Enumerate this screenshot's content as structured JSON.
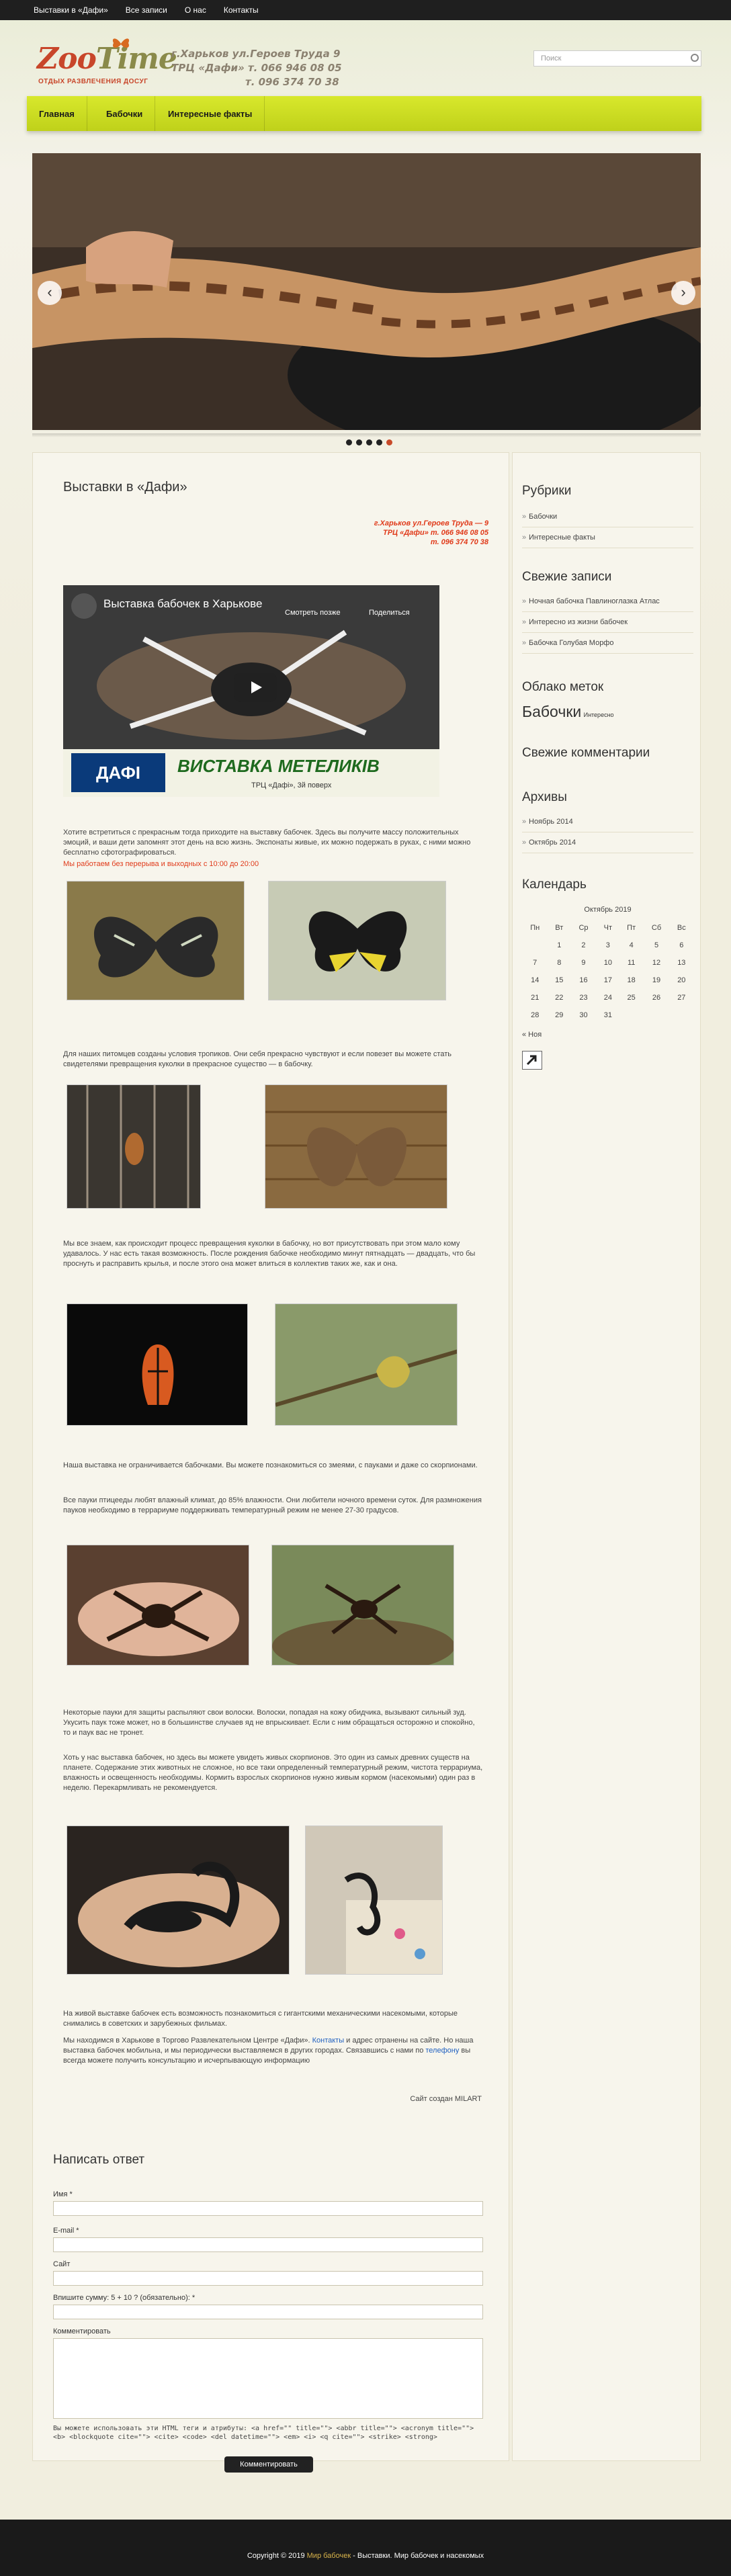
{
  "topnav": [
    "Выставки в «Дафи»",
    "Все записи",
    "О нас",
    "Контакты"
  ],
  "logo": {
    "brand_a": "Zoo",
    "brand_b": "Time",
    "tagline": "ОТДЫХ РАЗВЛЕЧЕНИЯ ДОСУГ"
  },
  "header_contact": [
    "г.Харьков   ул.Героев Труда 9",
    "ТРЦ «Дафи»   т.  066 946 08 05",
    "т.  096 374 70 38"
  ],
  "search": {
    "placeholder": "Поиск"
  },
  "mainnav": [
    "Главная",
    "Бабочки",
    "Интересные факты"
  ],
  "slider": {
    "prev": "‹",
    "next": "›",
    "dots": 5,
    "active_dot": 4
  },
  "post": {
    "title": "Выставки в «Дафи»",
    "address": [
      "г.Харьков     ул.Героев Труда — 9",
      "ТРЦ «Дафи»    т. 066 946 08 05",
      "т. 096 374 70 38"
    ],
    "video": {
      "title": "Выставка бабочек в Харькове",
      "later": "Смотреть позже",
      "share": "Поделиться",
      "banner_logo": "ДАФІ",
      "banner_title": "ВИСТАВКА МЕТЕЛИКІВ",
      "banner_sub": "ТРЦ «Дафі», 3й поверх"
    },
    "p1": "Хотите встретиться с прекрасным тогда приходите на выставку бабочек. Здесь вы получите массу положительных эмоций, и ваши дети запомнят этот день на всю жизнь. Экспонаты живые, их можно подержать в руках, с ними можно бесплатно сфотографироваться.",
    "p_hours": "Мы работаем без перерыва и выходных с 10:00 до 20:00",
    "p2": "Для наших питомцев созданы условия тропиков. Они себя прекрасно чувствуют и если повезет вы можете стать свидетелями превращения куколки в прекрасное существо — в бабочку.",
    "p3": "Мы все знаем, как происходит процесс превращения куколки в бабочку, но вот присутствовать при этом мало кому удавалось. У нас есть такая возможность. После рождения бабочке необходимо минут пятнадцать — двадцать, что бы проснуть и расправить крылья, и после этого она может влиться в коллектив таких же, как и она.",
    "p4": "Наша выставка не ограничивается бабочками. Вы можете познакомиться со змеями, с пауками и даже со скорпионами.",
    "p5": "Все пауки птицееды любят влажный климат, до 85% влажности. Они любители ночного времени суток. Для размножения пауков необходимо в террариуме поддерживать температурный режим не менее 27-30 градусов.",
    "p6": "Некоторые пауки для защиты распыляют свои волоски. Волоски, попадая на кожу обидчика, вызывают сильный зуд. Укусить паук тоже может, но в большинстве случаев яд не впрыскивает. Если с ним обращаться осторожно и спокойно, то и паук вас не тронет.",
    "p7": "Хоть у нас выставка бабочек, но здесь вы можете увидеть живых скорпионов. Это один из самых древних существ на планете. Содержание этих животных не сложное, но все таки определенный температурный режим, чистота террариума, влажность и освещенность необходимы. Кормить взрослых скорпионов нужно живым кормом (насекомыми) один раз в неделю. Перекармливать не рекомендуется.",
    "p8": "На живой выставке бабочек есть возможность познакомиться с гигантскими механическими насекомыми, которые снимались в советских и зарубежных фильмах.",
    "p9a": "Мы находимся в Харькове в Торгово Развлекательном Центре «Дафи». ",
    "p9link1": "Контакты",
    "p9b": " и адрес отранены на сайте. Но наша выставка бабочек мобильна, и мы периодически выставляемся в других городах. Связавшись с нами по ",
    "p9link2": "телефону",
    "p9c": " вы всегда можете получить консультацию и исчерпывающую информацию",
    "credit": "Сайт создан MILART"
  },
  "reply": {
    "title": "Написать ответ",
    "name": "Имя *",
    "email": "E-mail *",
    "site": "Сайт",
    "captcha": "Впишите сумму: 5 + 10 ? (обязательно): *",
    "comment": "Комментировать",
    "allowed": "Вы можете использовать эти HTML теги и атрибуты: <a href=\"\" title=\"\"> <abbr title=\"\"> <acronym title=\"\"> <b> <blockquote cite=\"\"> <cite> <code> <del datetime=\"\"> <em> <i> <q cite=\"\"> <strike> <strong>",
    "submit": "Комментировать"
  },
  "sidebar": {
    "rubrics_title": "Рубрики",
    "rubrics": [
      "Бабочки",
      "Интересные факты"
    ],
    "recent_title": "Свежие записи",
    "recent": [
      "Ночная бабочка Павлиноглазка Атлас",
      "Интересно из жизни бабочек",
      "Бабочка Голубая Морфо"
    ],
    "tags_title": "Облако меток",
    "tag_big": "Бабочки",
    "tag_small": "Интересно",
    "comments_title": "Свежие комментарии",
    "archive_title": "Архивы",
    "archive": [
      "Ноябрь 2014",
      "Октябрь 2014"
    ],
    "calendar_title": "Календарь",
    "calendar_caption": "Октябрь 2019",
    "calendar_days": [
      "Пн",
      "Вт",
      "Ср",
      "Чт",
      "Пт",
      "Сб",
      "Вс"
    ],
    "calendar_weeks": [
      [
        "",
        "1",
        "2",
        "3",
        "4",
        "5",
        "6"
      ],
      [
        "7",
        "8",
        "9",
        "10",
        "11",
        "12",
        "13"
      ],
      [
        "14",
        "15",
        "16",
        "17",
        "18",
        "19",
        "20"
      ],
      [
        "21",
        "22",
        "23",
        "24",
        "25",
        "26",
        "27"
      ],
      [
        "28",
        "29",
        "30",
        "31",
        "",
        "",
        ""
      ]
    ],
    "calendar_prev": "« Ноя"
  },
  "footer": {
    "copyright": "Copyright © 2019 ",
    "brand": "Мир бабочек",
    "rest": " - Выставки. Мир бабочек и насекомых"
  }
}
